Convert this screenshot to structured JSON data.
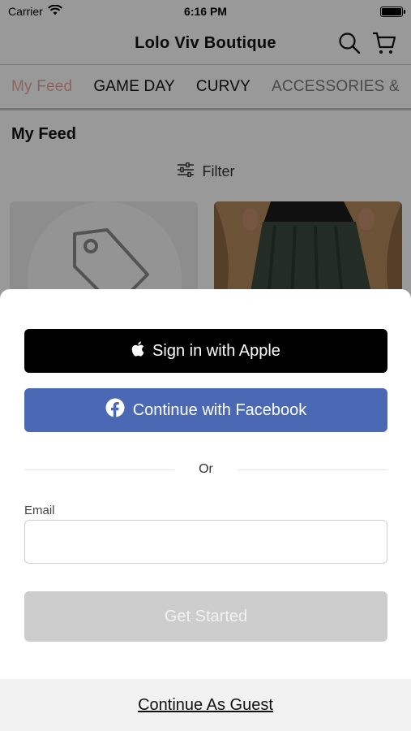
{
  "status_bar": {
    "carrier": "Carrier",
    "time": "6:16 PM"
  },
  "nav": {
    "title": "Lolo Viv Boutique",
    "search_icon": "search-icon",
    "cart_icon": "cart-icon"
  },
  "tabs": [
    {
      "label": "My Feed",
      "active": true
    },
    {
      "label": "GAME DAY",
      "active": false
    },
    {
      "label": "CURVY",
      "active": false
    },
    {
      "label": "ACCESSORIES &",
      "active": false
    }
  ],
  "feed": {
    "heading": "My Feed",
    "filter_label": "Filter"
  },
  "sheet": {
    "apple_label": "Sign in with Apple",
    "facebook_label": "Continue with Facebook",
    "or_label": "Or",
    "email_label": "Email",
    "email_value": "",
    "email_placeholder": "",
    "get_started_label": "Get Started",
    "guest_label": "Continue As Guest"
  },
  "colors": {
    "facebook": "#4a68b3",
    "accent": "#e58c84",
    "disabled_button": "#cdcdcd"
  }
}
